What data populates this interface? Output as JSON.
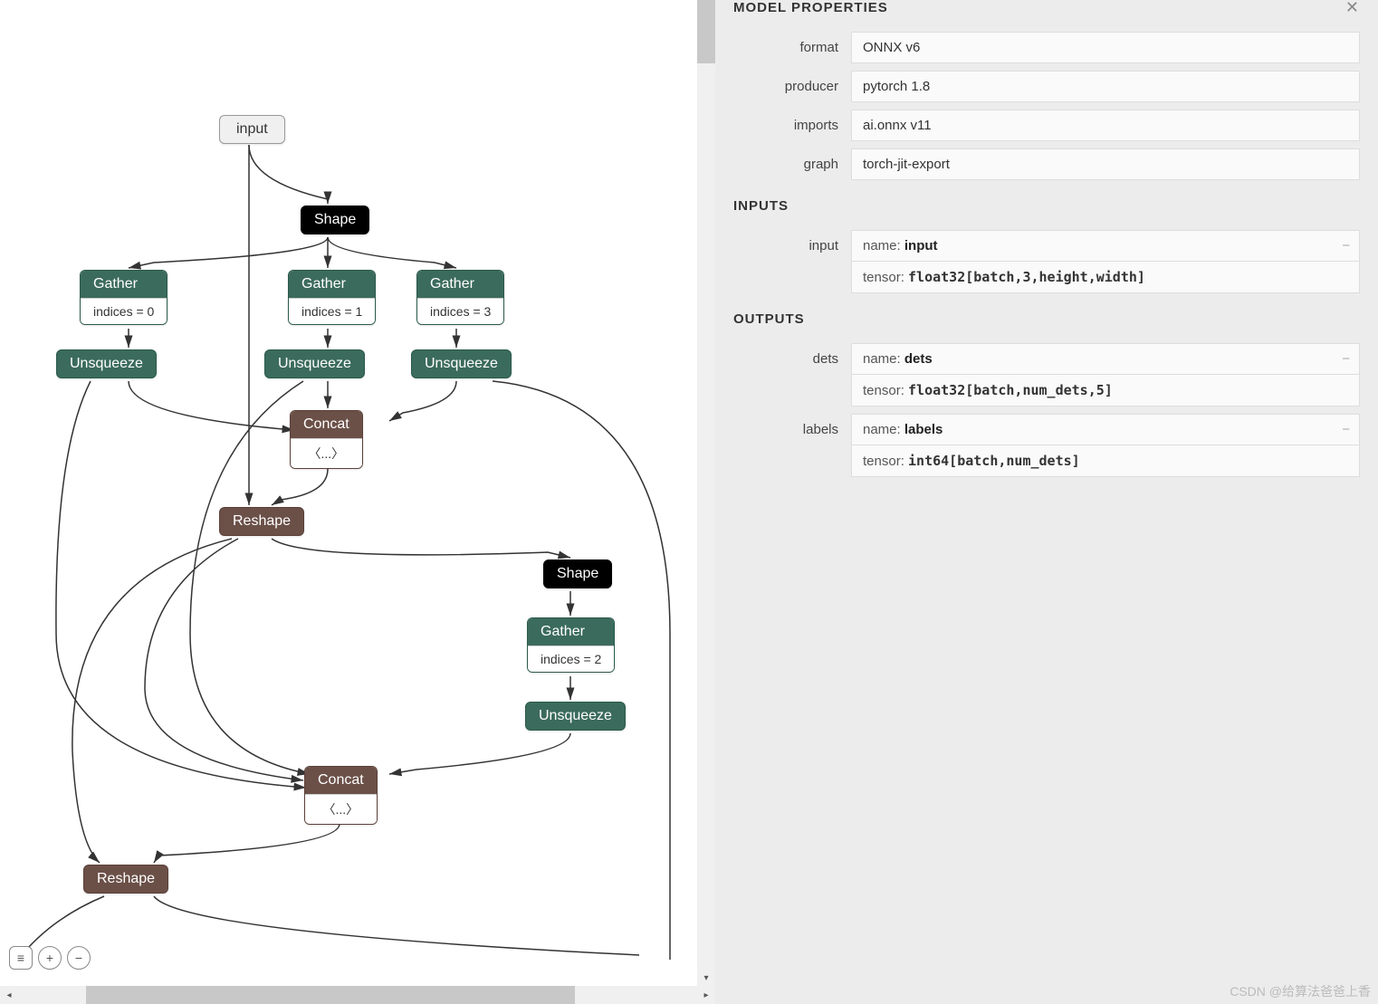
{
  "graph": {
    "nodes": {
      "input": {
        "label": "input"
      },
      "shape1": {
        "label": "Shape"
      },
      "gather1": {
        "head": "Gather",
        "body": "indices = 0"
      },
      "gather2": {
        "head": "Gather",
        "body": "indices = 1"
      },
      "gather3": {
        "head": "Gather",
        "body": "indices = 3"
      },
      "unsqueeze1": {
        "label": "Unsqueeze"
      },
      "unsqueeze2": {
        "label": "Unsqueeze"
      },
      "unsqueeze3": {
        "label": "Unsqueeze"
      },
      "concat1": {
        "head": "Concat",
        "body": "〈...〉"
      },
      "reshape1": {
        "label": "Reshape"
      },
      "shape2": {
        "label": "Shape"
      },
      "gather4": {
        "head": "Gather",
        "body": "indices = 2"
      },
      "unsqueeze4": {
        "label": "Unsqueeze"
      },
      "concat2": {
        "head": "Concat",
        "body": "〈...〉"
      },
      "reshape2": {
        "label": "Reshape"
      }
    }
  },
  "properties": {
    "sectionModel": "MODEL PROPERTIES",
    "format": {
      "label": "format",
      "value": "ONNX v6"
    },
    "producer": {
      "label": "producer",
      "value": "pytorch 1.8"
    },
    "imports": {
      "label": "imports",
      "value": "ai.onnx v11"
    },
    "graph": {
      "label": "graph",
      "value": "torch-jit-export"
    },
    "sectionInputs": "INPUTS",
    "input": {
      "label": "input",
      "name_prefix": "name: ",
      "name": "input",
      "tensor_prefix": "tensor: ",
      "tensor": "float32[batch,3,height,width]"
    },
    "sectionOutputs": "OUTPUTS",
    "dets": {
      "label": "dets",
      "name_prefix": "name: ",
      "name": "dets",
      "tensor_prefix": "tensor: ",
      "tensor": "float32[batch,num_dets,5]"
    },
    "labels": {
      "label": "labels",
      "name_prefix": "name: ",
      "name": "labels",
      "tensor_prefix": "tensor: ",
      "tensor": "int64[batch,num_dets]"
    }
  },
  "watermark": "CSDN @给算法爸爸上香"
}
